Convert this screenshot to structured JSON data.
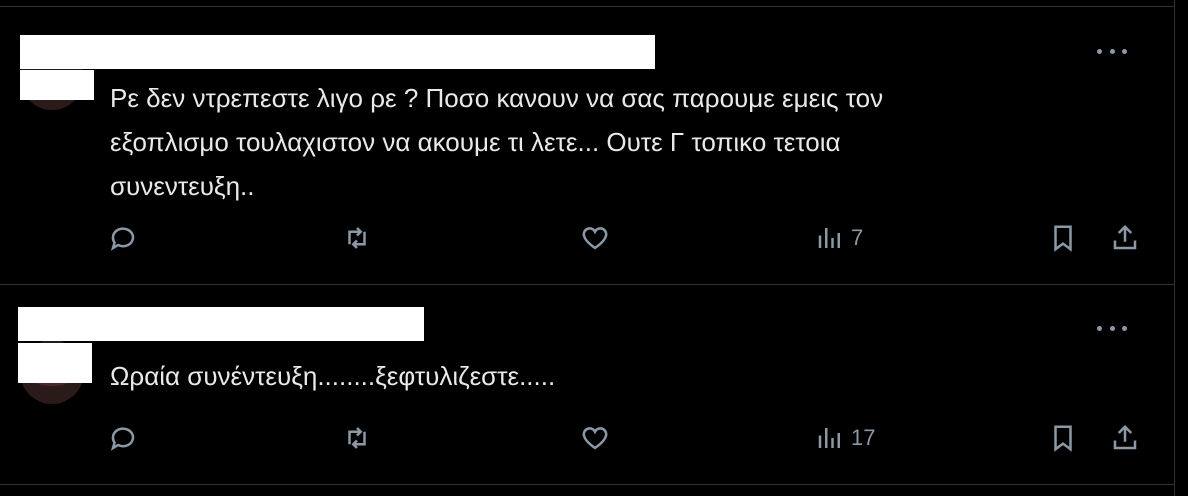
{
  "tweets": [
    {
      "text": "Ρε δεν ντρεπεστε λιγο ρε ? Ποσο κανουν να σας παρουμε εμεις τον\nεξοπλισμο τουλαχιστον να ακουμε τι λετε... Ουτε Γ τοπικο τετοια\nσυνεντευξη..",
      "views": "7",
      "icons": [
        "reply-icon",
        "retweet-icon",
        "like-icon",
        "views-icon",
        "bookmark-icon",
        "share-icon",
        "more-icon"
      ]
    },
    {
      "text": "Ωραία συνέντευξη........ξεφτυλιζεστε.....",
      "views": "17",
      "icons": [
        "reply-icon",
        "retweet-icon",
        "like-icon",
        "views-icon",
        "bookmark-icon",
        "share-icon",
        "more-icon"
      ]
    }
  ],
  "colors": {
    "background": "#000000",
    "text": "#e7e9ea",
    "icon": "#8b98a5",
    "separator": "#2f3336"
  }
}
